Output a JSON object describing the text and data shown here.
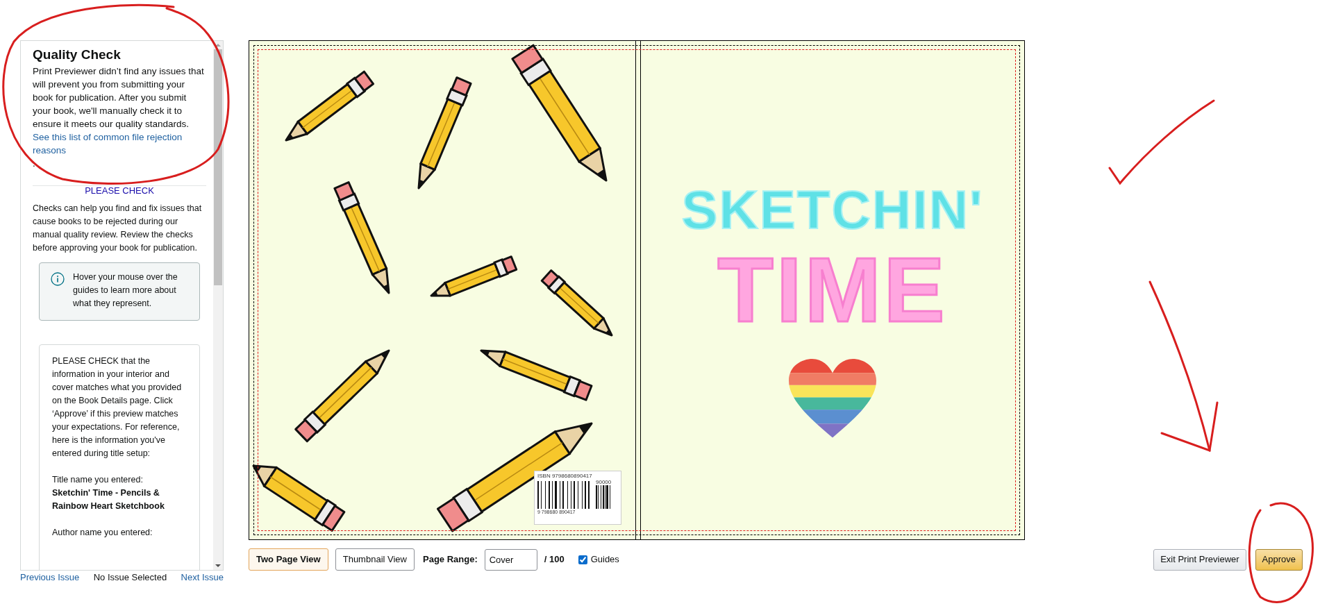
{
  "quality_check": {
    "title": "Quality Check",
    "body": "Print Previewer didn’t find any issues that will prevent you from submitting your book for publication. After you submit your book, we'll manually check it to ensure it meets our quality standards.",
    "link": "See this list of common file rejection reasons",
    "after_link": "."
  },
  "please_check": {
    "heading": "PLEASE CHECK",
    "intro": "Checks can help you find and fix issues that cause books to be rejected during our manual quality review. Review the checks before approving your book for publication.",
    "info_note": "Hover your mouse over the guides to learn more about what they represent.",
    "details": "PLEASE CHECK that the information in your interior and cover matches what you provided on the Book Details page. Click ‘Approve’ if this preview matches your expectations. For reference, here is the information you've entered during title setup:",
    "title_label": "Title name you entered:",
    "title_value": "Sketchin' Time - Pencils & Rainbow Heart Sketchbook",
    "author_label": "Author name you entered:"
  },
  "issue_nav": {
    "previous": "Previous Issue",
    "status": "No Issue Selected",
    "next": "Next Issue"
  },
  "cover": {
    "isbn": "ISBN 9798680890417",
    "price_code": "90000",
    "barcode_digits": "9 798680 890417",
    "title_line_1": "SKETCHIN'",
    "title_line_2": "TIME"
  },
  "toolbar": {
    "views": [
      {
        "label": "Two Page View",
        "selected": true
      },
      {
        "label": "Thumbnail View",
        "selected": false
      }
    ],
    "page_range": {
      "label": "Page Range:",
      "value": "Cover",
      "total": "/ 100"
    },
    "guides": {
      "label": "Guides",
      "checked": true
    }
  },
  "actions": [
    {
      "label": "Exit Print Previewer",
      "kind": "secondary"
    },
    {
      "label": "Approve",
      "kind": "primary"
    }
  ]
}
